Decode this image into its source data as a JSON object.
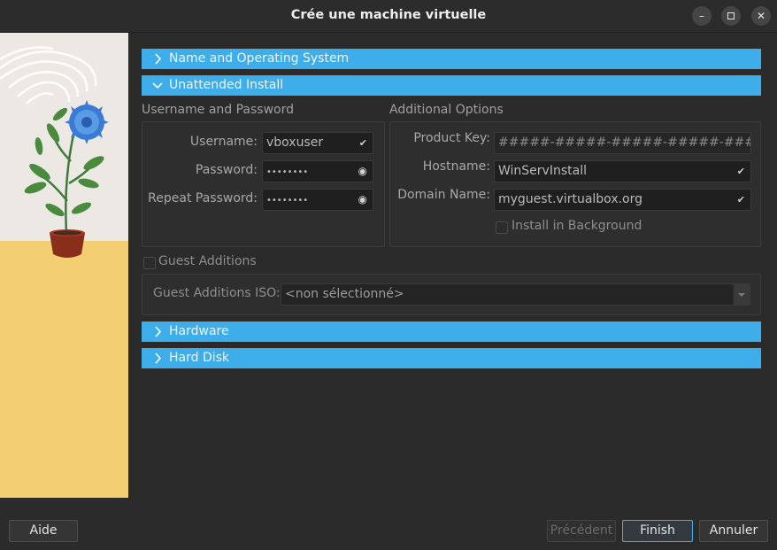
{
  "window": {
    "title": "Crée une machine virtuelle"
  },
  "sections": {
    "name_os": "Name and Operating System",
    "unattended": "Unattended Install",
    "hardware": "Hardware",
    "hard_disk": "Hard Disk"
  },
  "credentials": {
    "group_title": "Username and Password",
    "username_label": "Username:",
    "username_value": "vboxuser",
    "password_label": "Password:",
    "password_value": "••••••••",
    "repeat_label": "Repeat Password:",
    "repeat_value": "••••••••"
  },
  "additional": {
    "group_title": "Additional Options",
    "product_key_label": "Product Key:",
    "product_key_value": "#####-#####-#####-#####-#####",
    "hostname_label": "Hostname:",
    "hostname_value": "WinServInstall",
    "domain_label": "Domain Name:",
    "domain_value": "myguest.virtualbox.org",
    "background_label": "Install in Background"
  },
  "guest_additions": {
    "checkbox_label": "Guest Additions",
    "iso_label": "Guest Additions ISO:",
    "iso_value": "<non sélectionné>"
  },
  "footer": {
    "help": "Aide",
    "previous": "Précédent",
    "finish": "Finish",
    "cancel": "Annuler"
  },
  "icons": {
    "check": "check-icon",
    "eye": "eye-icon",
    "chevron_right": "chevron-right-icon",
    "chevron_down": "chevron-down-icon"
  },
  "colors": {
    "accent": "#3daee9",
    "background": "#2b2b2b",
    "sidebar_sand": "#f3cf72"
  }
}
